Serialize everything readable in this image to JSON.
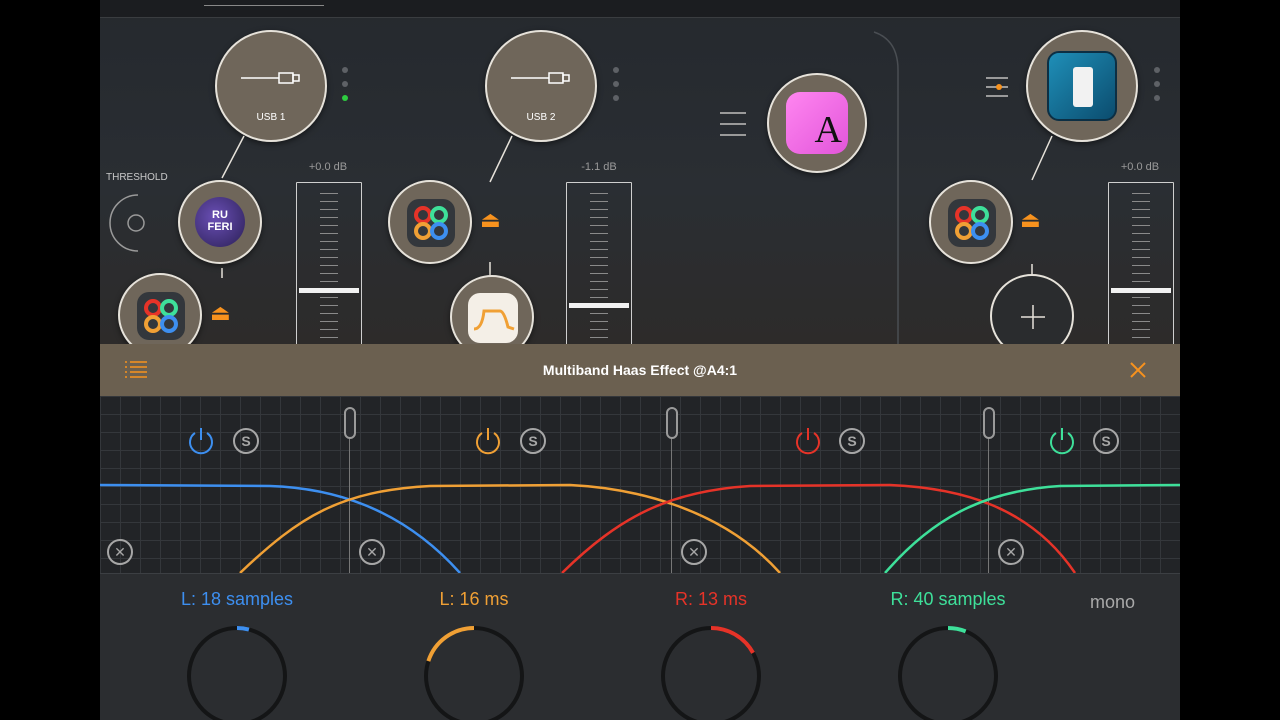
{
  "mixer": {
    "threshold_label": "THRESHOLD",
    "channels": [
      {
        "input_label": "USB 1",
        "db": "+0.0 dB",
        "fader_level": 0.78,
        "icons": [
          "ruferi-app-icon",
          "puzzle-app-icon"
        ]
      },
      {
        "input_label": "USB 2",
        "db": "-1.1 dB",
        "fader_level": 0.68,
        "icons": [
          "puzzle-app-icon",
          "filter-app-icon"
        ]
      },
      {
        "input_label": "",
        "db": "",
        "icons": [
          "pink-a-app-icon"
        ]
      },
      {
        "input_label": "",
        "db": "+0.0 dB",
        "fader_level": 0.78,
        "icons": [
          "drum-app-icon",
          "puzzle-app-icon",
          "add-icon"
        ]
      }
    ],
    "ruferi_text": "RU\nFERI",
    "pink_app_letter": "A"
  },
  "plugin": {
    "title": "Multiband Haas Effect @A4:1",
    "menu_icon": "list-icon",
    "close_icon": "close-icon",
    "solo_label": "S",
    "remove_label": "✕"
  },
  "bands": [
    {
      "label": "L: 18 samples",
      "color": "#3d8ff0",
      "knob_value": 0.04
    },
    {
      "label": "L: 16 ms",
      "color": "#f0a035",
      "knob_value": -0.2
    },
    {
      "label": "R: 13 ms",
      "color": "#e63328",
      "knob_value": 0.17
    },
    {
      "label": "R: 40 samples",
      "color": "#3ee09a",
      "knob_value": 0.06
    }
  ],
  "mono_label": "mono",
  "colors": {
    "accent": "#f7921e",
    "header_bg": "#6b6050"
  }
}
